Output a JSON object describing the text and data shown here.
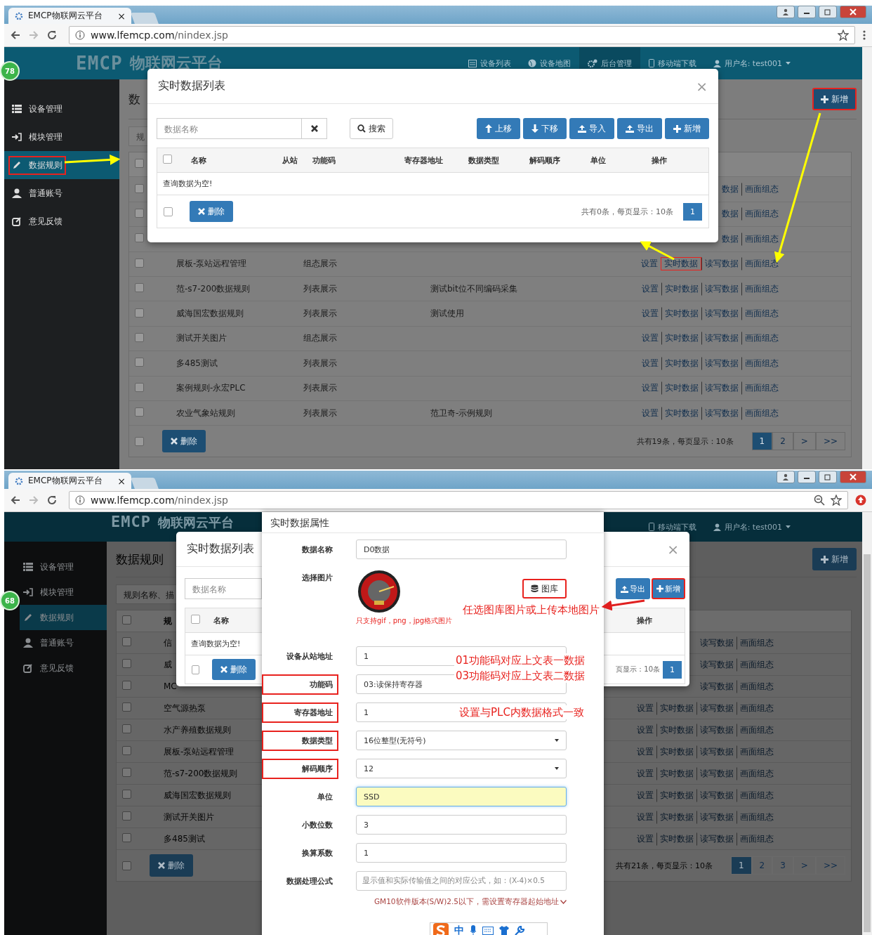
{
  "screens": [
    {
      "tab": {
        "title": "EMCP物联网云平台",
        "close": "×"
      },
      "url": {
        "host": "www.lfemcp.com",
        "path": "/nindex.jsp"
      },
      "header": {
        "logo": "EMCP",
        "logo_text": "物联网云平台",
        "nav": [
          {
            "label": "设备列表",
            "selected": false
          },
          {
            "label": "设备地图",
            "selected": false
          },
          {
            "label": "后台管理",
            "selected": true
          },
          {
            "label": "移动端下载",
            "selected": false
          }
        ],
        "user": "用户名: test001"
      },
      "badge": "78",
      "sidebar": [
        {
          "label": "设备管理",
          "selected": false,
          "marked": false
        },
        {
          "label": "模块管理",
          "selected": false,
          "marked": false
        },
        {
          "label": "数据规则",
          "selected": true,
          "marked": true
        },
        {
          "label": "普通账号",
          "selected": false,
          "marked": false
        },
        {
          "label": "意见反馈",
          "selected": false,
          "marked": false
        }
      ],
      "main": {
        "title": "数",
        "add_button": {
          "label": "新增",
          "marked": true
        },
        "search": {
          "placeholder": "规"
        },
        "header": {
          "checked": false
        },
        "rows": [
          {
            "checked": false,
            "actions": [
              {
                "label": "数据",
                "marked": false
              },
              {
                "label": "画面组态",
                "marked": false
              }
            ]
          },
          {
            "checked": false,
            "actions": [
              {
                "label": "数据",
                "marked": false
              },
              {
                "label": "画面组态",
                "marked": false
              }
            ]
          },
          {
            "checked": false,
            "actions": [
              {
                "label": "数据",
                "marked": false
              },
              {
                "label": "画面组态",
                "marked": false
              }
            ]
          },
          {
            "checked": false,
            "name": "展板-泵站远程管理",
            "mode": "组态展示",
            "actions": [
              {
                "label": "设置",
                "marked": false
              },
              {
                "label": "实时数据",
                "marked": true
              },
              {
                "label": "读写数据",
                "marked": false
              },
              {
                "label": "画面组态",
                "marked": false
              }
            ]
          },
          {
            "checked": false,
            "name": "范-s7-200数据规则",
            "mode": "列表展示",
            "desc": "测试bit位不同编码采集",
            "actions": [
              {
                "label": "设置",
                "marked": false
              },
              {
                "label": "实时数据",
                "marked": false
              },
              {
                "label": "读写数据",
                "marked": false
              },
              {
                "label": "画面组态",
                "marked": false
              }
            ]
          },
          {
            "checked": false,
            "name": "威海国宏数据规则",
            "mode": "列表展示",
            "desc": "测试使用",
            "actions": [
              {
                "label": "设置",
                "marked": false
              },
              {
                "label": "实时数据",
                "marked": false
              },
              {
                "label": "读写数据",
                "marked": false
              },
              {
                "label": "画面组态",
                "marked": false
              }
            ]
          },
          {
            "checked": false,
            "name": "测试开关图片",
            "mode": "组态展示",
            "actions": [
              {
                "label": "设置",
                "marked": false
              },
              {
                "label": "实时数据",
                "marked": false
              },
              {
                "label": "读写数据",
                "marked": false
              },
              {
                "label": "画面组态",
                "marked": false
              }
            ]
          },
          {
            "checked": false,
            "name": "多485测试",
            "mode": "列表展示",
            "actions": [
              {
                "label": "设置",
                "marked": false
              },
              {
                "label": "实时数据",
                "marked": false
              },
              {
                "label": "读写数据",
                "marked": false
              },
              {
                "label": "画面组态",
                "marked": false
              }
            ]
          },
          {
            "checked": false,
            "name": "案例规则-永宏PLC",
            "mode": "列表展示",
            "actions": [
              {
                "label": "设置",
                "marked": false
              },
              {
                "label": "实时数据",
                "marked": false
              },
              {
                "label": "读写数据",
                "marked": false
              },
              {
                "label": "画面组态",
                "marked": false
              }
            ]
          },
          {
            "checked": false,
            "name": "农业气象站规则",
            "mode": "列表展示",
            "desc": "范卫奇-示例规则",
            "actions": [
              {
                "label": "设置",
                "marked": false
              },
              {
                "label": "实时数据",
                "marked": false
              },
              {
                "label": "读写数据",
                "marked": false
              },
              {
                "label": "画面组态",
                "marked": false
              }
            ]
          }
        ],
        "footer": {
          "checked": false,
          "delete": "删除",
          "summary": "共有19条，每页显示：10条",
          "pages": [
            {
              "label": "1",
              "selected": true
            },
            {
              "label": "2",
              "selected": false
            },
            {
              "label": ">",
              "selected": false
            },
            {
              "label": ">>",
              "selected": false
            }
          ]
        }
      },
      "list_modal": {
        "kind": "full",
        "title": "实时数据列表",
        "close": "×",
        "search": {
          "placeholder": "数据名称"
        },
        "search_button": "搜索",
        "actions": [
          {
            "label": "上移",
            "marked": false
          },
          {
            "label": "下移",
            "marked": false
          },
          {
            "label": "导入",
            "marked": false
          },
          {
            "label": "导出",
            "marked": false
          },
          {
            "label": "新增",
            "marked": false
          }
        ],
        "columns": [
          "名称",
          "从站",
          "功能码",
          "寄存器地址",
          "数据类型",
          "解码顺序",
          "单位",
          "操作"
        ],
        "header_checked": false,
        "footer_checked": false,
        "empty": "查询数据为空!",
        "delete": "删除",
        "summary": "共有0条，每页显示：10条",
        "pages": [
          {
            "label": "1",
            "selected": true
          }
        ]
      }
    },
    {
      "tab": {
        "title": "EMCP物联网云平台",
        "close": "×"
      },
      "url": {
        "host": "www.lfemcp.com",
        "path": "/nindex.jsp"
      },
      "header": {
        "logo": "EMCP",
        "logo_text": "物联网云平台",
        "nav": [
          {
            "label": "移动端下载",
            "selected": false
          }
        ],
        "user": "用户名: test001"
      },
      "badge": "68",
      "sidebar": [
        {
          "label": "设备管理",
          "selected": false,
          "marked": false
        },
        {
          "label": "模块管理",
          "selected": false,
          "marked": false
        },
        {
          "label": "数据规则",
          "selected": true,
          "marked": false
        },
        {
          "label": "普通账号",
          "selected": false,
          "marked": false
        },
        {
          "label": "意见反馈",
          "selected": false,
          "marked": false
        }
      ],
      "main": {
        "title": "数据规则",
        "add_button": {
          "label": "新增",
          "marked": false
        },
        "search": {
          "placeholder": "规则名称、描"
        },
        "header": {
          "checked": false,
          "label": "规"
        },
        "rows": [
          {
            "checked": false,
            "name": "信",
            "actions": [
              {
                "label": "读写数据",
                "marked": false
              },
              {
                "label": "画面组态",
                "marked": false
              }
            ]
          },
          {
            "checked": false,
            "name": "威",
            "actions": [
              {
                "label": "读写数据",
                "marked": false
              },
              {
                "label": "画面组态",
                "marked": false
              }
            ]
          },
          {
            "checked": false,
            "name": "MC",
            "actions": [
              {
                "label": "读写数据",
                "marked": false
              },
              {
                "label": "画面组态",
                "marked": false
              }
            ]
          },
          {
            "checked": false,
            "name": "空气源热泵",
            "actions": [
              {
                "label": "设置",
                "marked": false
              },
              {
                "label": "实时数据",
                "marked": false
              },
              {
                "label": "读写数据",
                "marked": false
              },
              {
                "label": "画面组态",
                "marked": false
              }
            ]
          },
          {
            "checked": false,
            "name": "水产养殖数据规则",
            "actions": [
              {
                "label": "设置",
                "marked": false
              },
              {
                "label": "实时数据",
                "marked": false
              },
              {
                "label": "读写数据",
                "marked": false
              },
              {
                "label": "画面组态",
                "marked": false
              }
            ]
          },
          {
            "checked": false,
            "name": "展板-泵站远程管理",
            "actions": [
              {
                "label": "设置",
                "marked": false
              },
              {
                "label": "实时数据",
                "marked": false
              },
              {
                "label": "读写数据",
                "marked": false
              },
              {
                "label": "画面组态",
                "marked": false
              }
            ]
          },
          {
            "checked": false,
            "name": "范-s7-200数据规则",
            "actions": [
              {
                "label": "设置",
                "marked": false
              },
              {
                "label": "实时数据",
                "marked": false
              },
              {
                "label": "读写数据",
                "marked": false
              },
              {
                "label": "画面组态",
                "marked": false
              }
            ]
          },
          {
            "checked": false,
            "name": "威海国宏数据规则",
            "actions": [
              {
                "label": "设置",
                "marked": false
              },
              {
                "label": "实时数据",
                "marked": false
              },
              {
                "label": "读写数据",
                "marked": false
              },
              {
                "label": "画面组态",
                "marked": false
              }
            ]
          },
          {
            "checked": false,
            "name": "测试开关图片",
            "actions": [
              {
                "label": "设置",
                "marked": false
              },
              {
                "label": "实时数据",
                "marked": false
              },
              {
                "label": "读写数据",
                "marked": false
              },
              {
                "label": "画面组态",
                "marked": false
              }
            ]
          },
          {
            "checked": false,
            "name": "多485测试",
            "actions": [
              {
                "label": "设置",
                "marked": false
              },
              {
                "label": "实时数据",
                "marked": false
              },
              {
                "label": "读写数据",
                "marked": false
              },
              {
                "label": "画面组态",
                "marked": false
              }
            ]
          }
        ],
        "footer": {
          "checked": false,
          "delete": "删除",
          "summary": "共有21条，每页显示：10条",
          "pages": [
            {
              "label": "1",
              "selected": true
            },
            {
              "label": "2",
              "selected": false
            },
            {
              "label": "3",
              "selected": false
            },
            {
              "label": ">",
              "selected": false
            },
            {
              "label": ">>",
              "selected": false
            }
          ]
        }
      },
      "list_modal": {
        "kind": "split",
        "title": "实时数据列表",
        "close": "×",
        "search": {
          "placeholder": "数据名称"
        },
        "actions": [
          {
            "label": "导出",
            "marked": false
          },
          {
            "label": "新增",
            "marked": true
          }
        ],
        "columns": [
          "名称"
        ],
        "header_checked": false,
        "footer_checked": false,
        "end_column": "操作",
        "empty": "查询数据为空!",
        "delete": "删除",
        "summary": "页显示：10条",
        "pages": [
          {
            "label": "1",
            "selected": true
          }
        ]
      },
      "form_modal": {
        "title": "实时数据属性",
        "fields": [
          {
            "kind": "input",
            "label": "数据名称",
            "value": "D0数据",
            "marked": false,
            "focused": false
          },
          {
            "kind": "image",
            "label": "选择图片",
            "hint": "只支持gif，png，jpg格式图片",
            "button": {
              "label": "图库",
              "marked": true
            },
            "notes": [
              "任选图库图片或上传本地图片"
            ]
          },
          {
            "kind": "input",
            "label": "设备从站地址",
            "value": "1",
            "marked": false,
            "focused": false
          },
          {
            "kind": "input",
            "label": "功能码",
            "value": "03:读保持寄存器",
            "marked": true,
            "focused": false,
            "notes": [
              "01功能码对应上文表一数据",
              "03功能码对应上文表二数据"
            ]
          },
          {
            "kind": "input",
            "label": "寄存器地址",
            "value": "1",
            "marked": true,
            "focused": false,
            "notes": [
              "设置与PLC内数据格式一致"
            ]
          },
          {
            "kind": "select",
            "label": "数据类型",
            "value": "16位整型(无符号)",
            "marked": true
          },
          {
            "kind": "select",
            "label": "解码顺序",
            "value": "12",
            "marked": true
          },
          {
            "kind": "input",
            "label": "单位",
            "value": "SSD",
            "marked": false,
            "focused": true
          },
          {
            "kind": "input",
            "label": "小数位数",
            "value": "3",
            "marked": false,
            "focused": false
          },
          {
            "kind": "input",
            "label": "换算系数",
            "value": "1",
            "marked": false,
            "focused": false
          },
          {
            "kind": "input",
            "label": "数据处理公式",
            "placeholder": "显示值和实际传输值之间的对应公式，如：(X-4)×0.5",
            "marked": false,
            "focused": false
          }
        ],
        "link": "GM10软件版本(S/W)2.5以下，需设置寄存器起始地址"
      },
      "ime": {
        "label": "中"
      }
    }
  ]
}
